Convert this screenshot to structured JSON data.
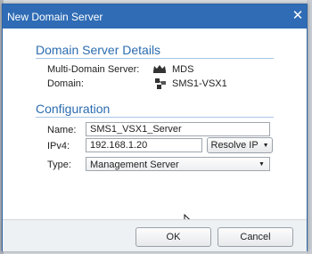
{
  "dialog": {
    "title": "New Domain Server",
    "close_glyph": "✕"
  },
  "details": {
    "heading": "Domain Server Details",
    "mds_label": "Multi-Domain Server:",
    "mds_value": "MDS",
    "mds_icon": "crown-icon",
    "domain_label": "Domain:",
    "domain_value": "SMS1-VSX1",
    "domain_icon": "server-icon"
  },
  "configuration": {
    "heading": "Configuration",
    "name_label": "Name:",
    "name_value": "SMS1_VSX1_Server",
    "ipv4_label": "IPv4:",
    "ipv4_value": "192.168.1.20",
    "resolve_label": "Resolve IP",
    "type_label": "Type:",
    "type_value": "Management Server"
  },
  "footer": {
    "ok_label": "OK",
    "cancel_label": "Cancel"
  },
  "colors": {
    "titlebar": "#2f6cb5",
    "heading": "#2b6cb0"
  }
}
